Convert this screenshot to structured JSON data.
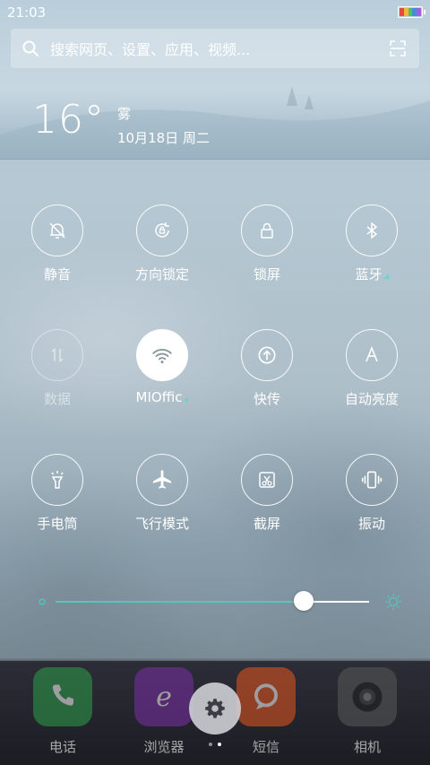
{
  "status_bar": {
    "time": "21:03",
    "battery_colors": [
      "#e9483e",
      "#f3b53a",
      "#55c05a",
      "#3f8fe0",
      "#a55de0"
    ]
  },
  "search": {
    "placeholder": "搜索网页、设置、应用、视频...",
    "search_icon": "search-icon",
    "scan_icon": "scan-icon"
  },
  "weather": {
    "temperature": "16°",
    "condition": "雾",
    "date": "10月18日 周二"
  },
  "toggles": [
    {
      "label": "静音",
      "icon": "bell-off-icon",
      "state": "off"
    },
    {
      "label": "方向锁定",
      "icon": "rotation-lock-icon",
      "state": "off"
    },
    {
      "label": "锁屏",
      "icon": "lock-icon",
      "state": "off"
    },
    {
      "label": "蓝牙",
      "icon": "bluetooth-icon",
      "state": "off"
    },
    {
      "label": "数据",
      "icon": "mobile-data-icon",
      "state": "disabled"
    },
    {
      "label": "MIOffic",
      "icon": "wifi-icon",
      "state": "on"
    },
    {
      "label": "快传",
      "icon": "quick-transfer-icon",
      "state": "off"
    },
    {
      "label": "自动亮度",
      "icon": "auto-brightness-icon",
      "state": "off"
    },
    {
      "label": "手电筒",
      "icon": "flashlight-icon",
      "state": "off"
    },
    {
      "label": "飞行模式",
      "icon": "airplane-icon",
      "state": "off"
    },
    {
      "label": "截屏",
      "icon": "screenshot-icon",
      "state": "off"
    },
    {
      "label": "振动",
      "icon": "vibrate-icon",
      "state": "off"
    }
  ],
  "brightness": {
    "level": 0.79,
    "accent": "#54c7bd"
  },
  "dock": [
    {
      "label": "电话",
      "icon": "phone-icon",
      "color": "#2e9e4a"
    },
    {
      "label": "浏览器",
      "icon": "browser-icon",
      "color": "#7b2fa8"
    },
    {
      "label": "短信",
      "icon": "message-icon",
      "color": "#e8561e"
    },
    {
      "label": "相机",
      "icon": "camera-icon",
      "color": "#5a5a5a"
    }
  ],
  "settings_button": {
    "icon": "gear-icon"
  }
}
